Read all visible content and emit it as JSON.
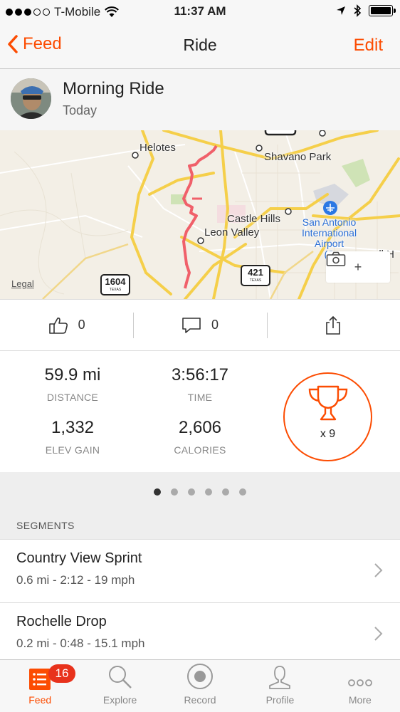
{
  "status_bar": {
    "carrier": "T-Mobile",
    "time": "11:37 AM",
    "signal_bars_filled": 3,
    "signal_bars_total": 5,
    "battery_level": 1.0
  },
  "nav": {
    "back_label": "Feed",
    "title": "Ride",
    "edit_label": "Edit"
  },
  "activity": {
    "title": "Morning Ride",
    "date": "Today"
  },
  "map": {
    "labels": {
      "helotes": "Helotes",
      "shavano_park": "Shavano Park",
      "castle_hills": "Castle Hills",
      "leon_valley": "Leon Valley",
      "airport_line1": "San Antonio",
      "airport_line2": "International",
      "airport_line3": "Airport",
      "airport_line4": "(S",
      "ell_h": "ell H"
    },
    "highway_1604": "1604",
    "highway_421": "421",
    "highway_state": "TEXAS",
    "legal": "Legal",
    "zoom_in": "+"
  },
  "social": {
    "kudos_count": "0",
    "comments_count": "0"
  },
  "stats": {
    "distance_value": "59.9 mi",
    "distance_label": "DISTANCE",
    "time_value": "3:56:17",
    "time_label": "TIME",
    "elev_value": "1,332",
    "elev_label": "ELEV GAIN",
    "calories_value": "2,606",
    "calories_label": "CALORIES",
    "achievements": "x 9"
  },
  "pager": {
    "count": 6,
    "active_index": 0
  },
  "segments": {
    "header": "SEGMENTS",
    "items": [
      {
        "name": "Country View Sprint",
        "stats": "0.6 mi - 2:12 - 19 mph"
      },
      {
        "name": "Rochelle Drop",
        "stats": "0.2 mi - 0:48 - 15.1 mph"
      }
    ]
  },
  "tabs": {
    "feed": "Feed",
    "feed_badge": "16",
    "explore": "Explore",
    "record": "Record",
    "profile": "Profile",
    "more": "More"
  },
  "colors": {
    "accent": "#fc4c02",
    "badge": "#e8321c",
    "route": "#f0606a"
  }
}
